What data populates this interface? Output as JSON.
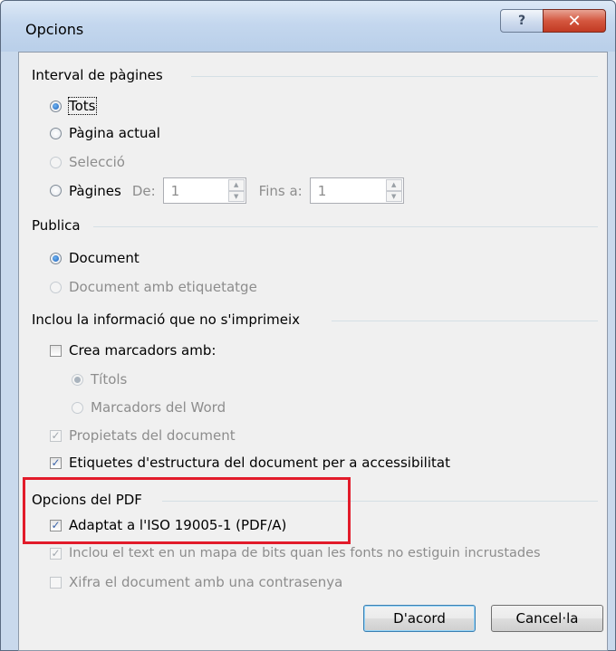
{
  "window": {
    "title": "Opcions",
    "help_glyph": "?",
    "close_glyph": "✕"
  },
  "page_range": {
    "title": "Interval de pàgines",
    "options": {
      "all": "Tots",
      "current": "Pàgina actual",
      "selection": "Selecció",
      "pages": "Pàgines"
    },
    "from_label": "De:",
    "from_value": "1",
    "to_label": "Fins a:",
    "to_value": "1"
  },
  "publish": {
    "title": "Publica",
    "document": "Document",
    "tagged": "Document amb etiquetatge"
  },
  "nonprint": {
    "title": "Inclou la informació que no s'imprimeix",
    "bookmarks": "Crea marcadors amb:",
    "headings": "Títols",
    "word_bookmarks": "Marcadors del Word",
    "properties": "Propietats del document",
    "structure_tags": "Etiquetes d'estructura del document per a accessibilitat"
  },
  "pdf": {
    "title": "Opcions del PDF",
    "iso": "Adaptat a l'ISO 19005-1 (PDF/A)",
    "bitmap": "Inclou el text en un mapa de bits quan les fonts no estiguin incrustades",
    "encrypt": "Xifra el document amb una contrasenya"
  },
  "buttons": {
    "ok": "D'acord",
    "cancel": "Cancel·la"
  },
  "colors": {
    "highlight": "#e21b2a",
    "accent": "#1c5fb8"
  }
}
